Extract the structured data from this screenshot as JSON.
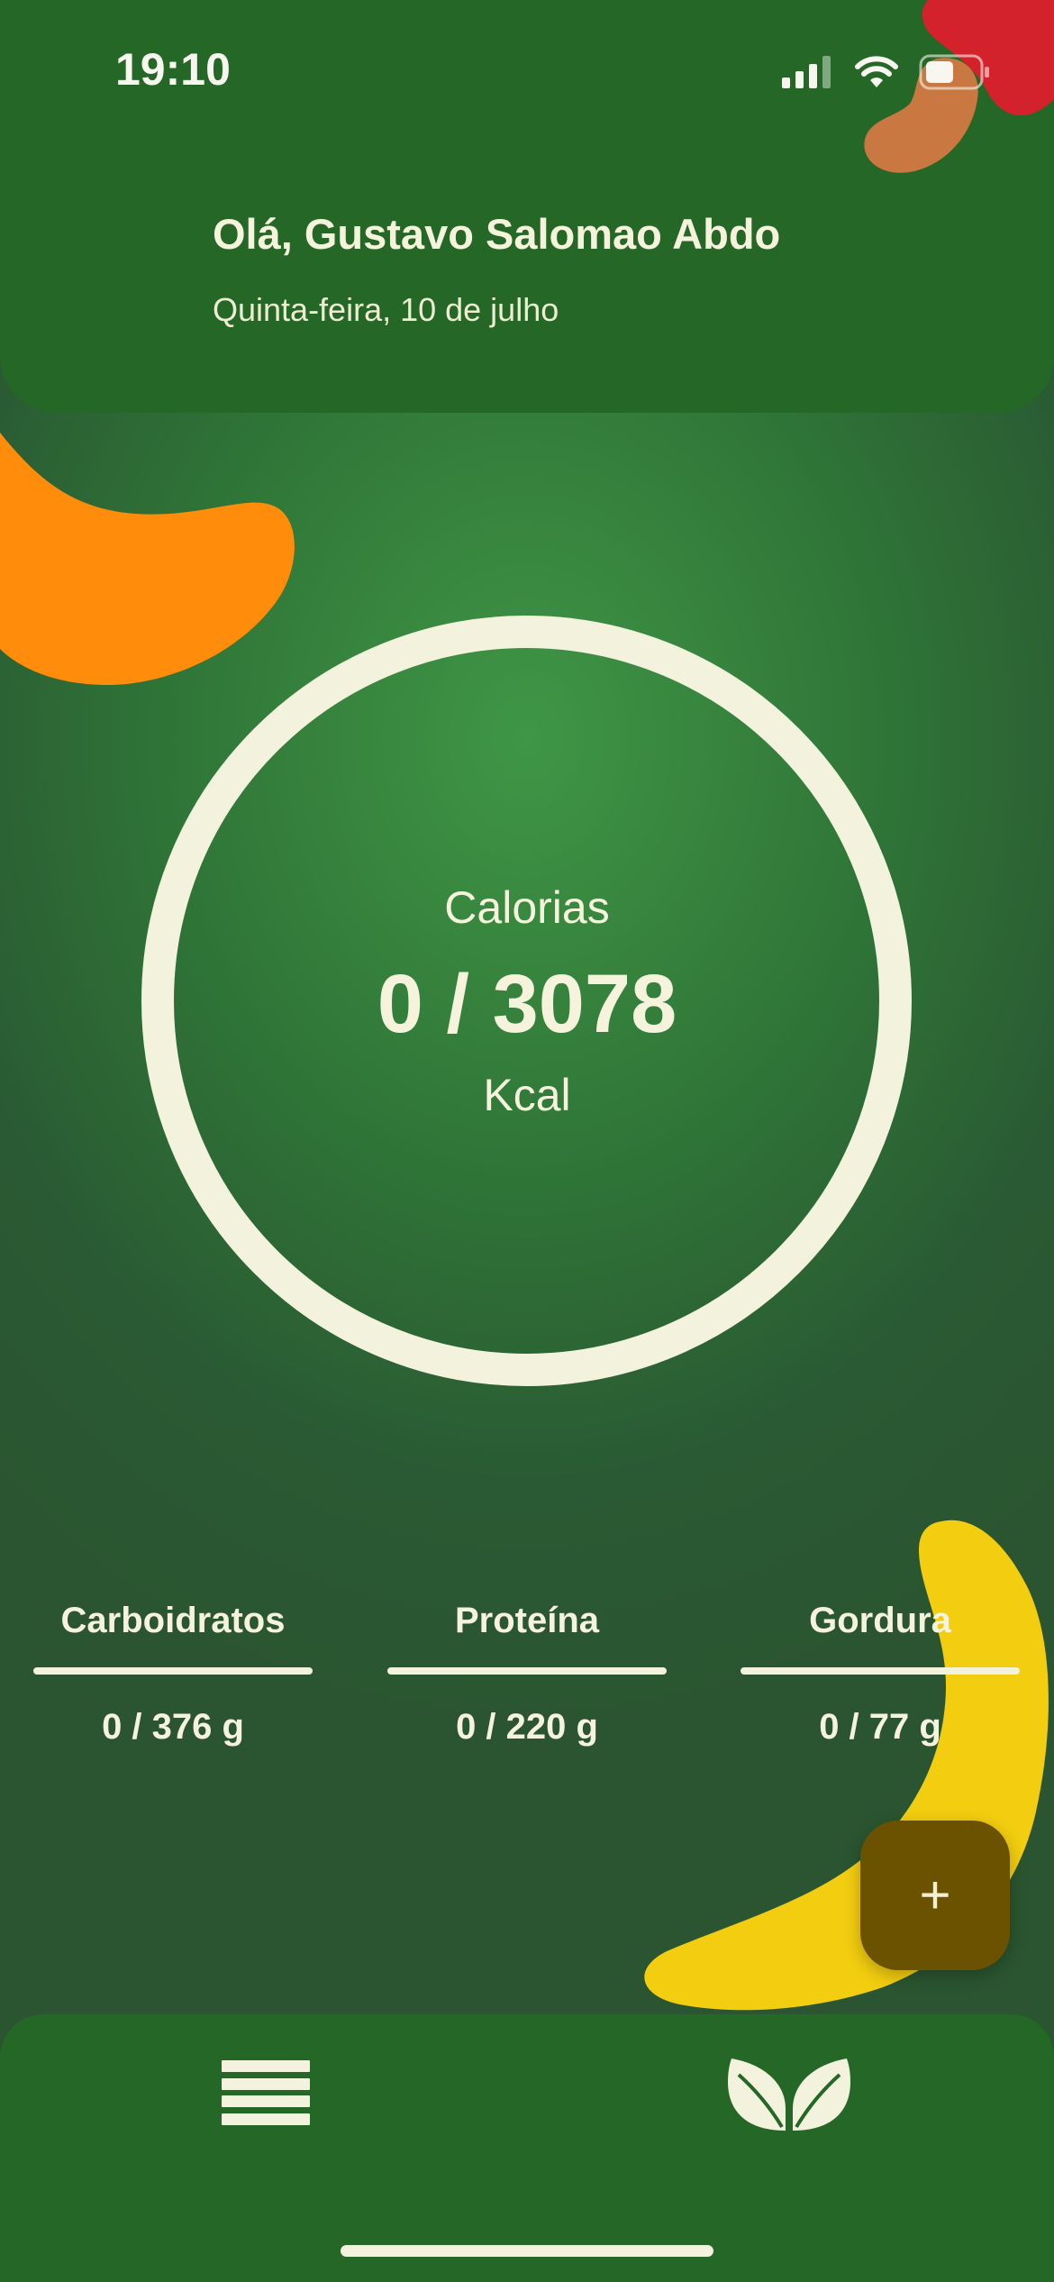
{
  "status_bar": {
    "time": "19:10",
    "icons": [
      "signal-icon",
      "wifi-icon",
      "battery-icon"
    ]
  },
  "header": {
    "greeting": "Olá, Gustavo Salomao Abdo",
    "date": "Quinta-feira, 10 de julho"
  },
  "calories": {
    "label": "Calorias",
    "value": "0 / 3078",
    "unit": "Kcal",
    "progress": 0
  },
  "macros": [
    {
      "name": "Carboidratos",
      "value": "0 / 376 g",
      "progress": 0
    },
    {
      "name": "Proteína",
      "value": "0 / 220 g",
      "progress": 0
    },
    {
      "name": "Gordura",
      "value": "0 / 77 g",
      "progress": 0
    }
  ],
  "fab": {
    "label": "+",
    "icon": "plus-icon"
  },
  "bottom_nav": {
    "items": [
      {
        "icon": "menu-icon"
      },
      {
        "icon": "leaf-icon"
      }
    ]
  },
  "colors": {
    "header_green": "#256726",
    "cream": "#f3f2dc",
    "fab_brown": "#6b5200",
    "orange_blob": "#ff8c0a",
    "yellow_blob": "#f2cd10",
    "red_blob": "#d4222c",
    "tan_blob": "#c87840"
  }
}
